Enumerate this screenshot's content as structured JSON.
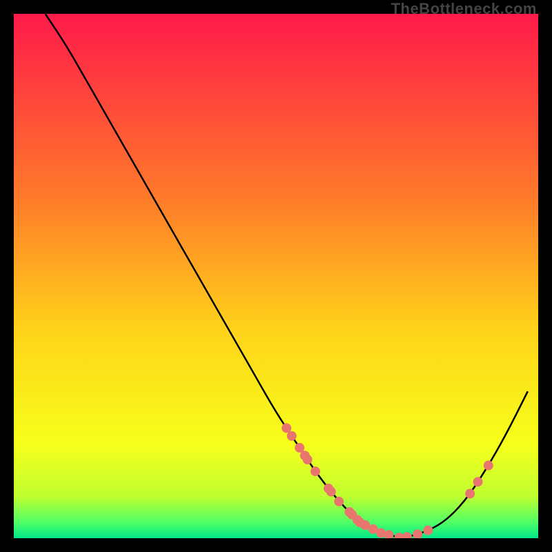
{
  "watermark": "TheBottleneck.com",
  "colors": {
    "background": "#000000",
    "line": "#000000",
    "point": "#e8766e",
    "gradient_stops": [
      {
        "offset": 0.0,
        "color": "#ff1a4a"
      },
      {
        "offset": 0.35,
        "color": "#ff7a2a"
      },
      {
        "offset": 0.6,
        "color": "#ffd21a"
      },
      {
        "offset": 0.82,
        "color": "#f7ff1a"
      },
      {
        "offset": 0.92,
        "color": "#c0ff30"
      },
      {
        "offset": 0.97,
        "color": "#4fff66"
      },
      {
        "offset": 1.0,
        "color": "#00e88a"
      }
    ]
  },
  "chart_data": {
    "type": "line",
    "title": "",
    "xlabel": "",
    "ylabel": "",
    "x": [
      0.06,
      0.1,
      0.14,
      0.18,
      0.22,
      0.26,
      0.3,
      0.34,
      0.38,
      0.42,
      0.46,
      0.5,
      0.54,
      0.58,
      0.62,
      0.66,
      0.7,
      0.74,
      0.78,
      0.82,
      0.86,
      0.9,
      0.94,
      0.98
    ],
    "values": [
      1.0,
      0.94,
      0.87,
      0.8,
      0.73,
      0.66,
      0.59,
      0.52,
      0.45,
      0.38,
      0.31,
      0.24,
      0.18,
      0.12,
      0.07,
      0.03,
      0.01,
      0.0,
      0.01,
      0.03,
      0.07,
      0.13,
      0.2,
      0.28
    ],
    "ylim": [
      0,
      1
    ],
    "xlim": [
      0,
      1
    ],
    "points_on_curve_x": [
      0.52,
      0.53,
      0.545,
      0.555,
      0.56,
      0.575,
      0.6,
      0.605,
      0.62,
      0.64,
      0.645,
      0.655,
      0.66,
      0.67,
      0.685,
      0.7,
      0.715,
      0.735,
      0.75,
      0.77,
      0.79,
      0.87,
      0.885,
      0.905
    ]
  }
}
